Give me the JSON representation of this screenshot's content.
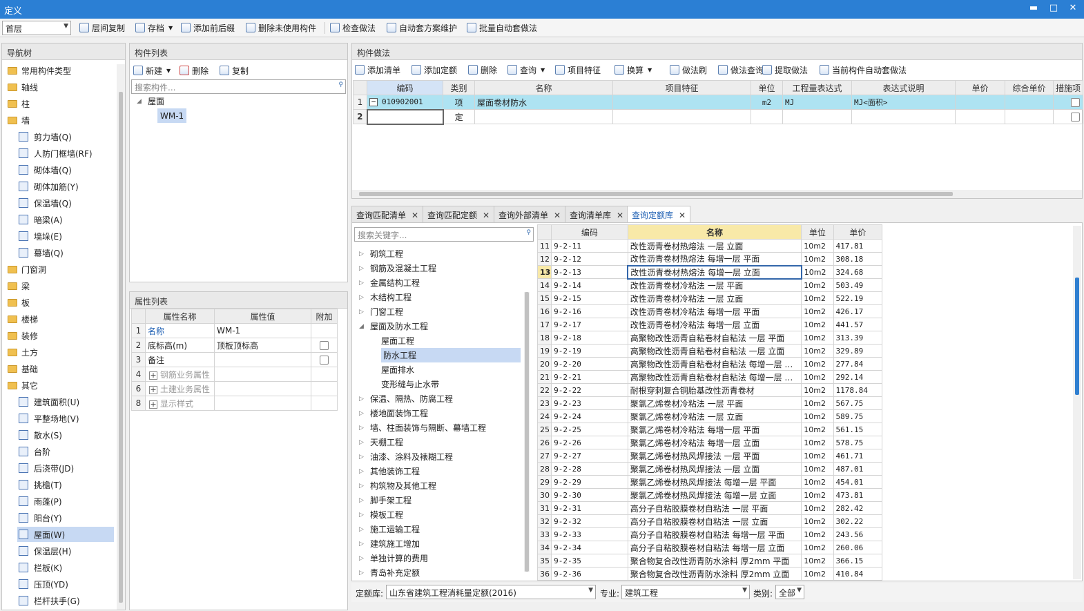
{
  "window": {
    "title": "定义",
    "min": "▬",
    "max": "□",
    "close": "✕"
  },
  "toolbar": {
    "floor": "首层",
    "buttons": [
      "层间复制",
      "存档",
      "添加前后缀",
      "删除未使用构件",
      "检查做法",
      "自动套方案维护",
      "批量自动套做法"
    ]
  },
  "nav": {
    "title": "导航树",
    "items": [
      {
        "label": "常用构件类型",
        "type": "folder",
        "level": 0
      },
      {
        "label": "轴线",
        "type": "folder",
        "level": 0
      },
      {
        "label": "柱",
        "type": "folder",
        "level": 0
      },
      {
        "label": "墙",
        "type": "folder",
        "level": 0
      },
      {
        "label": "剪力墙(Q)",
        "type": "item",
        "level": 1
      },
      {
        "label": "人防门框墙(RF)",
        "type": "item",
        "level": 1
      },
      {
        "label": "砌体墙(Q)",
        "type": "item",
        "level": 1
      },
      {
        "label": "砌体加筋(Y)",
        "type": "item",
        "level": 1
      },
      {
        "label": "保温墙(Q)",
        "type": "item",
        "level": 1
      },
      {
        "label": "暗梁(A)",
        "type": "item",
        "level": 1
      },
      {
        "label": "墙垛(E)",
        "type": "item",
        "level": 1
      },
      {
        "label": "幕墙(Q)",
        "type": "item",
        "level": 1
      },
      {
        "label": "门窗洞",
        "type": "folder",
        "level": 0
      },
      {
        "label": "梁",
        "type": "folder",
        "level": 0
      },
      {
        "label": "板",
        "type": "folder",
        "level": 0
      },
      {
        "label": "楼梯",
        "type": "folder",
        "level": 0
      },
      {
        "label": "装修",
        "type": "folder",
        "level": 0
      },
      {
        "label": "土方",
        "type": "folder",
        "level": 0
      },
      {
        "label": "基础",
        "type": "folder",
        "level": 0
      },
      {
        "label": "其它",
        "type": "folder",
        "level": 0
      },
      {
        "label": "建筑面积(U)",
        "type": "item",
        "level": 1
      },
      {
        "label": "平整场地(V)",
        "type": "item",
        "level": 1
      },
      {
        "label": "散水(S)",
        "type": "item",
        "level": 1
      },
      {
        "label": "台阶",
        "type": "item",
        "level": 1
      },
      {
        "label": "后浇带(JD)",
        "type": "item",
        "level": 1
      },
      {
        "label": "挑檐(T)",
        "type": "item",
        "level": 1
      },
      {
        "label": "雨蓬(P)",
        "type": "item",
        "level": 1
      },
      {
        "label": "阳台(Y)",
        "type": "item",
        "level": 1
      },
      {
        "label": "屋面(W)",
        "type": "item",
        "level": 1,
        "selected": true
      },
      {
        "label": "保温层(H)",
        "type": "item",
        "level": 1
      },
      {
        "label": "栏板(K)",
        "type": "item",
        "level": 1
      },
      {
        "label": "压顶(YD)",
        "type": "item",
        "level": 1
      },
      {
        "label": "栏杆扶手(G)",
        "type": "item",
        "level": 1
      }
    ]
  },
  "complist": {
    "title": "构件列表",
    "new": "新建",
    "delete": "删除",
    "copy": "复制",
    "search_placeholder": "搜索构件...",
    "root": "屋面",
    "child": "WM-1"
  },
  "props": {
    "title": "属性列表",
    "headers": [
      "属性名称",
      "属性值",
      "附加"
    ],
    "rows": [
      {
        "n": "1",
        "name": "名称",
        "value": "WM-1",
        "chk": false,
        "blue": true
      },
      {
        "n": "2",
        "name": "底标高(m)",
        "value": "顶板顶标高",
        "chk": true
      },
      {
        "n": "3",
        "name": "备注",
        "value": "",
        "chk": true
      },
      {
        "n": "4",
        "name": "钢筋业务属性",
        "value": "",
        "chk": false,
        "group": true
      },
      {
        "n": "6",
        "name": "土建业务属性",
        "value": "",
        "chk": false,
        "group": true
      },
      {
        "n": "8",
        "name": "显示样式",
        "value": "",
        "chk": false,
        "group": true
      }
    ]
  },
  "method": {
    "title": "构件做法",
    "buttons": [
      "添加清单",
      "添加定额",
      "删除",
      "查询",
      "项目特征",
      "换算",
      "做法刷",
      "做法查询",
      "提取做法",
      "当前构件自动套做法"
    ],
    "headers": [
      "编码",
      "类别",
      "名称",
      "项目特征",
      "单位",
      "工程量表达式",
      "表达式说明",
      "单价",
      "综合单价",
      "措施项"
    ],
    "rows": [
      {
        "n": "1",
        "code": "010902001",
        "cat": "项",
        "name": "屋面卷材防水",
        "feat": "",
        "unit": "m2",
        "expr": "MJ",
        "desc": "MJ<面积>",
        "price": "",
        "cprice": ""
      },
      {
        "n": "2",
        "code": "",
        "cat": "定",
        "name": "",
        "feat": "",
        "unit": "",
        "expr": "",
        "desc": "",
        "price": "",
        "cprice": ""
      }
    ]
  },
  "tabs": [
    "查询匹配清单",
    "查询匹配定额",
    "查询外部清单",
    "查询清单库",
    "查询定额库"
  ],
  "query": {
    "search_placeholder": "搜索关键字...",
    "tree": [
      {
        "label": "砌筑工程",
        "open": false
      },
      {
        "label": "钢筋及混凝土工程",
        "open": false
      },
      {
        "label": "金属结构工程",
        "open": false
      },
      {
        "label": "木结构工程",
        "open": false
      },
      {
        "label": "门窗工程",
        "open": false
      },
      {
        "label": "屋面及防水工程",
        "open": true
      },
      {
        "label": "屋面工程",
        "child": true
      },
      {
        "label": "防水工程",
        "child": true,
        "selected": true
      },
      {
        "label": "屋面排水",
        "child": true
      },
      {
        "label": "变形缝与止水带",
        "child": true
      },
      {
        "label": "保温、隔热、防腐工程",
        "open": false
      },
      {
        "label": "楼地面装饰工程",
        "open": false
      },
      {
        "label": "墙、柱面装饰与隔断、幕墙工程",
        "open": false
      },
      {
        "label": "天棚工程",
        "open": false
      },
      {
        "label": "油漆、涂料及裱糊工程",
        "open": false
      },
      {
        "label": "其他装饰工程",
        "open": false
      },
      {
        "label": "构筑物及其他工程",
        "open": false
      },
      {
        "label": "脚手架工程",
        "open": false
      },
      {
        "label": "模板工程",
        "open": false
      },
      {
        "label": "施工运输工程",
        "open": false
      },
      {
        "label": "建筑施工增加",
        "open": false
      },
      {
        "label": "单独计算的费用",
        "open": false
      },
      {
        "label": "青岛补充定额",
        "open": false
      }
    ],
    "headers": [
      "编码",
      "名称",
      "单位",
      "单价"
    ],
    "rows": [
      [
        "11",
        "9-2-11",
        "改性沥青卷材热熔法 一层 立面",
        "10m2",
        "417.81"
      ],
      [
        "12",
        "9-2-12",
        "改性沥青卷材热熔法 每增一层 平面",
        "10m2",
        "308.18"
      ],
      [
        "13",
        "9-2-13",
        "改性沥青卷材热熔法 每增一层 立面",
        "10m2",
        "324.68"
      ],
      [
        "14",
        "9-2-14",
        "改性沥青卷材冷粘法 一层 平面",
        "10m2",
        "503.49"
      ],
      [
        "15",
        "9-2-15",
        "改性沥青卷材冷粘法 一层 立面",
        "10m2",
        "522.19"
      ],
      [
        "16",
        "9-2-16",
        "改性沥青卷材冷粘法 每增一层 平面",
        "10m2",
        "426.17"
      ],
      [
        "17",
        "9-2-17",
        "改性沥青卷材冷粘法 每增一层 立面",
        "10m2",
        "441.57"
      ],
      [
        "18",
        "9-2-18",
        "高聚物改性沥青自粘卷材自粘法 一层 平面",
        "10m2",
        "313.39"
      ],
      [
        "19",
        "9-2-19",
        "高聚物改性沥青自粘卷材自粘法 一层 立面",
        "10m2",
        "329.89"
      ],
      [
        "20",
        "9-2-20",
        "高聚物改性沥青自粘卷材自粘法 每增一层 …",
        "10m2",
        "277.84"
      ],
      [
        "21",
        "9-2-21",
        "高聚物改性沥青自粘卷材自粘法 每增一层 …",
        "10m2",
        "292.14"
      ],
      [
        "22",
        "9-2-22",
        "耐根穿刺复合铜胎基改性沥青卷材",
        "10m2",
        "1178.84"
      ],
      [
        "23",
        "9-2-23",
        "聚氯乙烯卷材冷粘法 一层 平面",
        "10m2",
        "567.75"
      ],
      [
        "24",
        "9-2-24",
        "聚氯乙烯卷材冷粘法 一层 立面",
        "10m2",
        "589.75"
      ],
      [
        "25",
        "9-2-25",
        "聚氯乙烯卷材冷粘法 每增一层 平面",
        "10m2",
        "561.15"
      ],
      [
        "26",
        "9-2-26",
        "聚氯乙烯卷材冷粘法 每增一层 立面",
        "10m2",
        "578.75"
      ],
      [
        "27",
        "9-2-27",
        "聚氯乙烯卷材热风焊接法 一层 平面",
        "10m2",
        "461.71"
      ],
      [
        "28",
        "9-2-28",
        "聚氯乙烯卷材热风焊接法 一层 立面",
        "10m2",
        "487.01"
      ],
      [
        "29",
        "9-2-29",
        "聚氯乙烯卷材热风焊接法 每增一层 平面",
        "10m2",
        "454.01"
      ],
      [
        "30",
        "9-2-30",
        "聚氯乙烯卷材热风焊接法 每增一层 立面",
        "10m2",
        "473.81"
      ],
      [
        "31",
        "9-2-31",
        "高分子自粘胶膜卷材自粘法 一层 平面",
        "10m2",
        "282.42"
      ],
      [
        "32",
        "9-2-32",
        "高分子自粘胶膜卷材自粘法 一层 立面",
        "10m2",
        "302.22"
      ],
      [
        "33",
        "9-2-33",
        "高分子自粘胶膜卷材自粘法 每增一层 平面",
        "10m2",
        "243.56"
      ],
      [
        "34",
        "9-2-34",
        "高分子自粘胶膜卷材自粘法 每增一层 立面",
        "10m2",
        "260.06"
      ],
      [
        "35",
        "9-2-35",
        "聚合物复合改性沥青防水涂料 厚2mm 平面",
        "10m2",
        "366.15"
      ],
      [
        "36",
        "9-2-36",
        "聚合物复合改性沥青防水涂料 厚2mm 立面",
        "10m2",
        "410.84"
      ]
    ],
    "selected_row": "13",
    "footer": {
      "lib_label": "定额库:",
      "lib_value": "山东省建筑工程消耗量定额(2016)",
      "spec_label": "专业:",
      "spec_value": "建筑工程",
      "cat_label": "类别:",
      "cat_value": "全部"
    }
  }
}
